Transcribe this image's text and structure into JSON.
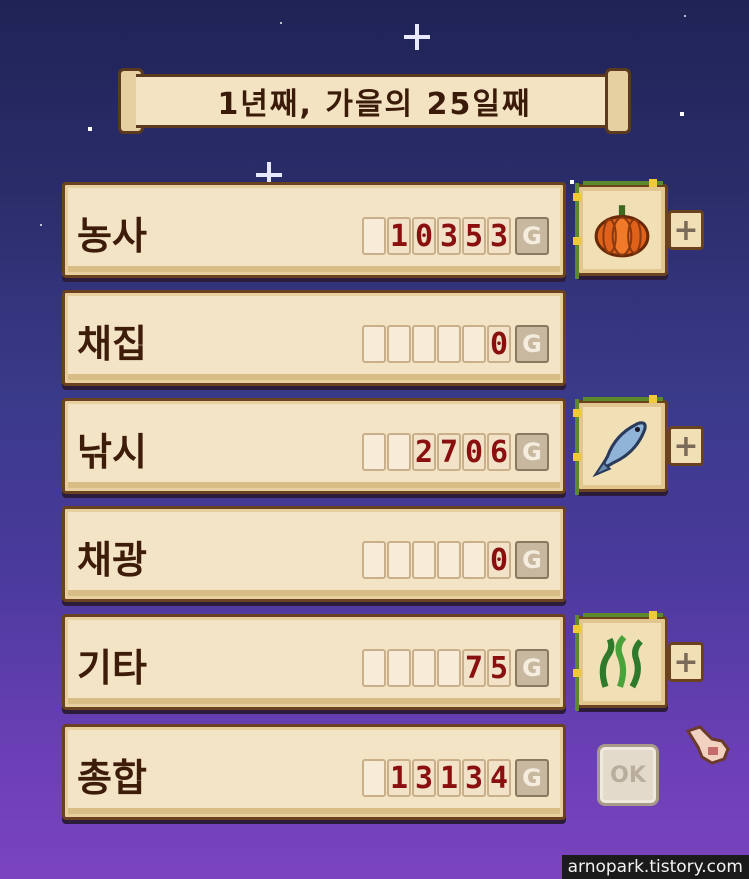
{
  "title": "1년째, 가을의 25일째",
  "currency_symbol": "G",
  "categories": [
    {
      "label": "농사",
      "value": "10353",
      "slots": 6,
      "item_icon": "pumpkin-icon",
      "has_plus": true
    },
    {
      "label": "채집",
      "value": "0",
      "slots": 6,
      "item_icon": null,
      "has_plus": false
    },
    {
      "label": "낚시",
      "value": "2706",
      "slots": 6,
      "item_icon": "fish-icon",
      "has_plus": true
    },
    {
      "label": "채광",
      "value": "0",
      "slots": 6,
      "item_icon": null,
      "has_plus": false
    },
    {
      "label": "기타",
      "value": "75",
      "slots": 6,
      "item_icon": "seaweed-icon",
      "has_plus": true
    },
    {
      "label": "총합",
      "value": "13134",
      "slots": 6,
      "item_icon": null,
      "has_plus": false
    }
  ],
  "plus_label": "+",
  "ok_label": "OK",
  "watermark": "arnopark.tistory.com",
  "colors": {
    "digit": "#8a0f0f",
    "panel": "#f4e4c6",
    "border": "#6a4220"
  }
}
